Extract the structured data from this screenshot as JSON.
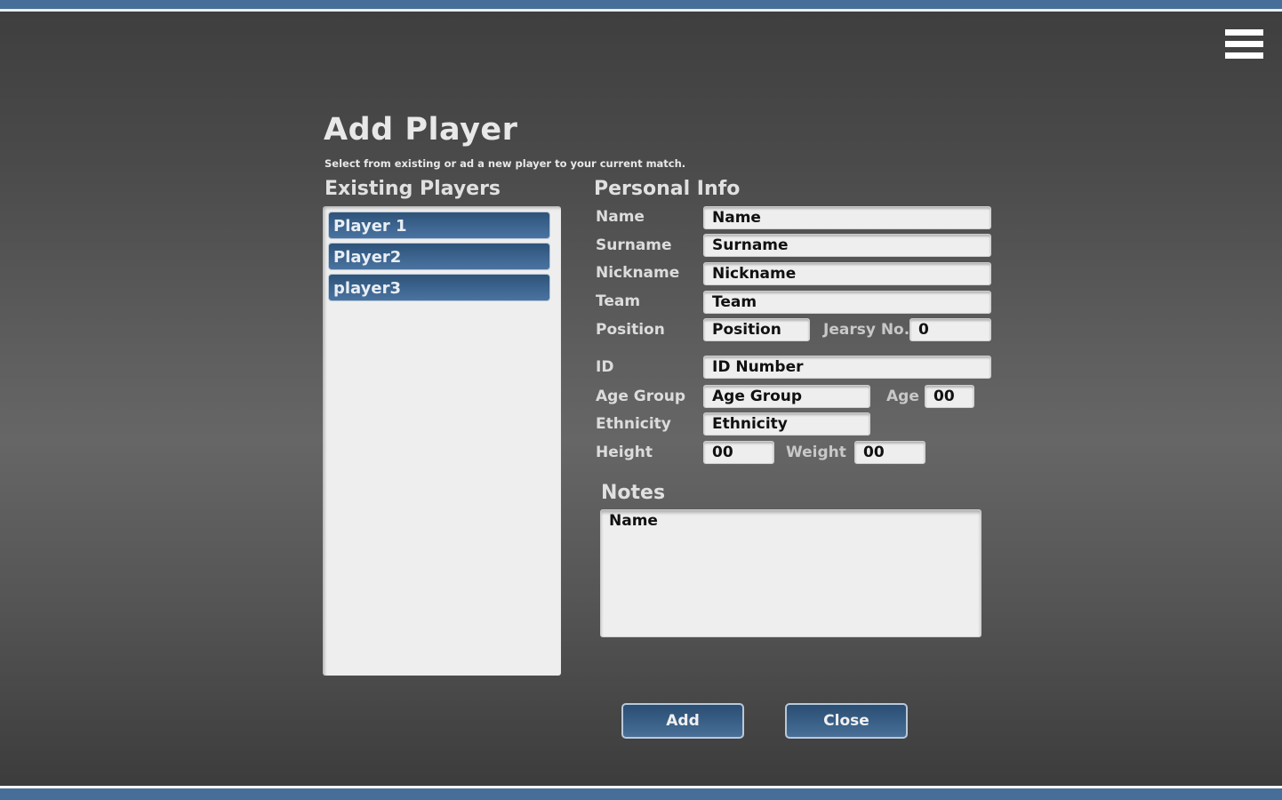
{
  "header": {
    "title": "Add Player",
    "subtitle": "Select from existing or ad a new player to your current match.",
    "menu_icon": "hamburger-menu-icon"
  },
  "existing_players": {
    "heading": "Existing Players",
    "items": [
      "Player 1",
      "Player2",
      "player3"
    ]
  },
  "personal_info": {
    "heading": "Personal Info",
    "fields": {
      "name": {
        "label": "Name",
        "value": "Name"
      },
      "surname": {
        "label": "Surname",
        "value": "Surname"
      },
      "nickname": {
        "label": "Nickname",
        "value": "Nickname"
      },
      "team": {
        "label": "Team",
        "value": "Team"
      },
      "position": {
        "label": "Position",
        "value": "Position"
      },
      "jersey_no": {
        "label": "Jearsy No.",
        "value": "0"
      },
      "id": {
        "label": "ID",
        "value": "ID Number"
      },
      "age_group": {
        "label": "Age Group",
        "value": "Age Group"
      },
      "age": {
        "label": "Age",
        "value": "00"
      },
      "ethnicity": {
        "label": "Ethnicity",
        "value": "Ethnicity"
      },
      "height": {
        "label": "Height",
        "value": "00"
      },
      "weight": {
        "label": "Weight",
        "value": "00"
      }
    }
  },
  "notes": {
    "heading": "Notes",
    "value": "Name"
  },
  "actions": {
    "add_label": "Add",
    "close_label": "Close"
  },
  "colors": {
    "accent_blue": "#466e98",
    "button_blue": "#3b6289",
    "field_bg": "#eeeeee"
  }
}
